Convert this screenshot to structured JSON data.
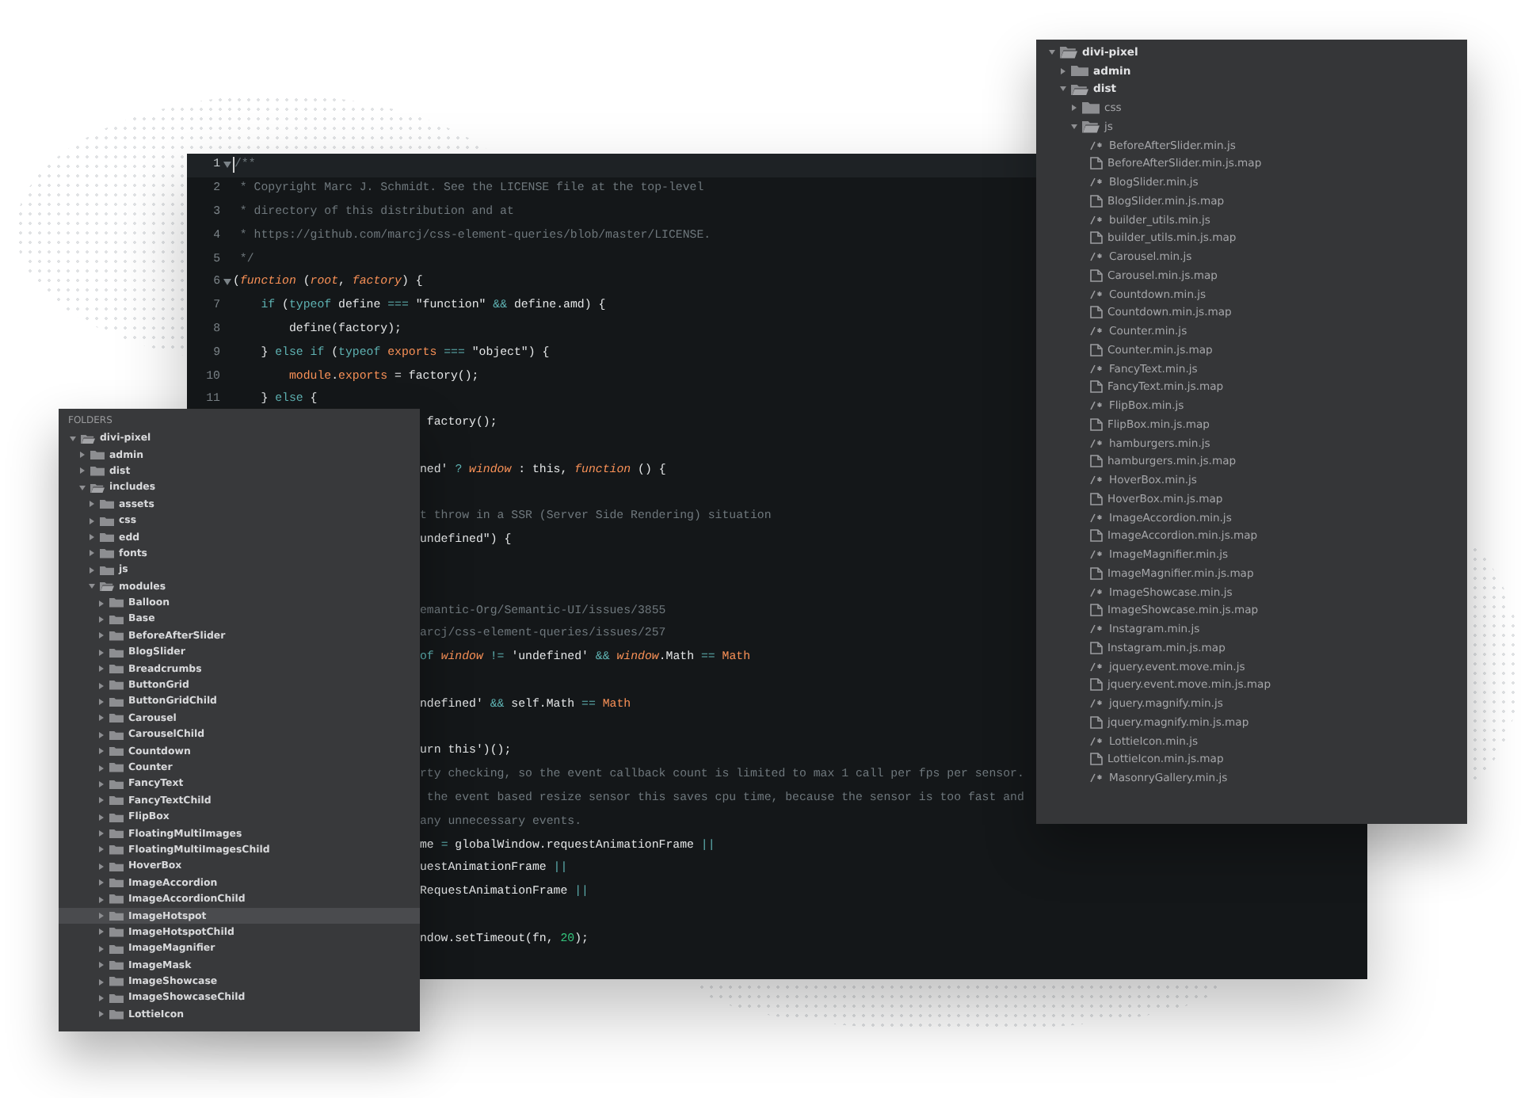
{
  "editor": {
    "lines": [
      {
        "kind": "full",
        "number": "1",
        "active": true,
        "foldable": true,
        "tokens": [
          {
            "t": "/**",
            "kind": "comment"
          }
        ]
      },
      {
        "kind": "full",
        "number": "2",
        "active": false,
        "foldable": false,
        "tokens": [
          {
            "t": " * Copyright Marc J. Schmidt. See the LICENSE file at the top-level",
            "kind": "comment"
          }
        ]
      },
      {
        "kind": "full",
        "number": "3",
        "active": false,
        "foldable": false,
        "tokens": [
          {
            "t": " * directory of this distribution and at",
            "kind": "comment"
          }
        ]
      },
      {
        "kind": "full",
        "number": "4",
        "active": false,
        "foldable": false,
        "tokens": [
          {
            "t": " * https://github.com/marcj/css-element-queries/blob/master/LICENSE.",
            "kind": "comment"
          }
        ]
      },
      {
        "kind": "full",
        "number": "5",
        "active": false,
        "foldable": false,
        "tokens": [
          {
            "t": " */",
            "kind": "comment"
          }
        ]
      },
      {
        "kind": "full",
        "number": "6",
        "active": false,
        "foldable": true,
        "tokens": [
          {
            "t": "(",
            "kind": "plain"
          },
          {
            "t": "function",
            "kind": "variable"
          },
          {
            "t": " (",
            "kind": "plain"
          },
          {
            "t": "root",
            "kind": "variable"
          },
          {
            "t": ", ",
            "kind": "plain"
          },
          {
            "t": "factory",
            "kind": "variable"
          },
          {
            "t": ") {",
            "kind": "plain"
          }
        ]
      },
      {
        "kind": "full",
        "number": "7",
        "active": false,
        "foldable": false,
        "tokens": [
          {
            "t": "    if",
            "kind": "keyword"
          },
          {
            "t": " (",
            "kind": "plain"
          },
          {
            "t": "typeof",
            "kind": "keyword"
          },
          {
            "t": " define ",
            "kind": "plain"
          },
          {
            "t": "===",
            "kind": "operator"
          },
          {
            "t": " \"function\" ",
            "kind": "string"
          },
          {
            "t": "&&",
            "kind": "operator"
          },
          {
            "t": " define.amd) {",
            "kind": "plain"
          }
        ]
      },
      {
        "kind": "full",
        "number": "8",
        "active": false,
        "foldable": false,
        "tokens": [
          {
            "t": "        define(factory);",
            "kind": "plain"
          }
        ]
      },
      {
        "kind": "full",
        "number": "9",
        "active": false,
        "foldable": false,
        "tokens": [
          {
            "t": "    } ",
            "kind": "plain"
          },
          {
            "t": "else if",
            "kind": "keyword"
          },
          {
            "t": " (",
            "kind": "plain"
          },
          {
            "t": "typeof",
            "kind": "keyword"
          },
          {
            "t": " exports ",
            "kind": "property"
          },
          {
            "t": "===",
            "kind": "operator"
          },
          {
            "t": " \"object\"",
            "kind": "string"
          },
          {
            "t": ") {",
            "kind": "plain"
          }
        ]
      },
      {
        "kind": "full",
        "number": "10",
        "active": false,
        "foldable": false,
        "tokens": [
          {
            "t": "        module",
            "kind": "property"
          },
          {
            "t": ".",
            "kind": "plain"
          },
          {
            "t": "exports",
            "kind": "property"
          },
          {
            "t": " = factory();",
            "kind": "plain"
          }
        ]
      },
      {
        "kind": "full",
        "number": "11",
        "active": false,
        "foldable": false,
        "tokens": [
          {
            "t": "    } ",
            "kind": "plain"
          },
          {
            "t": "else",
            "kind": "keyword"
          },
          {
            "t": " {",
            "kind": "plain"
          }
        ]
      },
      {
        "kind": "clipped",
        "tokens": [
          {
            "t": " factory();",
            "kind": "plain"
          }
        ]
      },
      {
        "kind": "blank"
      },
      {
        "kind": "clipped",
        "tokens": [
          {
            "t": "ned' ",
            "kind": "string"
          },
          {
            "t": "?",
            "kind": "operator"
          },
          {
            "t": " window",
            "kind": "variable"
          },
          {
            "t": " : this, ",
            "kind": "plain"
          },
          {
            "t": "function",
            "kind": "variable"
          },
          {
            "t": " () {",
            "kind": "plain"
          }
        ]
      },
      {
        "kind": "blank"
      },
      {
        "kind": "clipped",
        "tokens": [
          {
            "t": "t throw in a SSR (Server Side Rendering) situation",
            "kind": "comment"
          }
        ]
      },
      {
        "kind": "clipped",
        "tokens": [
          {
            "t": "undefined\"",
            "kind": "string"
          },
          {
            "t": ") {",
            "kind": "plain"
          }
        ]
      },
      {
        "kind": "blank"
      },
      {
        "kind": "blank"
      },
      {
        "kind": "clipped",
        "tokens": [
          {
            "t": "emantic-Org/Semantic-UI/issues/3855",
            "kind": "comment"
          }
        ]
      },
      {
        "kind": "clipped",
        "tokens": [
          {
            "t": "arcj/css-element-queries/issues/257",
            "kind": "comment"
          }
        ]
      },
      {
        "kind": "clipped",
        "tokens": [
          {
            "t": "of ",
            "kind": "keyword"
          },
          {
            "t": "window",
            "kind": "variable"
          },
          {
            "t": " != ",
            "kind": "operator"
          },
          {
            "t": "'undefined' ",
            "kind": "string"
          },
          {
            "t": "&&",
            "kind": "operator"
          },
          {
            "t": " window",
            "kind": "variable"
          },
          {
            "t": ".Math ",
            "kind": "plain"
          },
          {
            "t": "==",
            "kind": "operator"
          },
          {
            "t": " Math",
            "kind": "property"
          }
        ]
      },
      {
        "kind": "blank"
      },
      {
        "kind": "clipped",
        "tokens": [
          {
            "t": "ndefined' ",
            "kind": "string"
          },
          {
            "t": "&&",
            "kind": "operator"
          },
          {
            "t": " self.Math ",
            "kind": "plain"
          },
          {
            "t": "==",
            "kind": "operator"
          },
          {
            "t": " Math",
            "kind": "property"
          }
        ]
      },
      {
        "kind": "blank"
      },
      {
        "kind": "clipped",
        "tokens": [
          {
            "t": "urn this')();",
            "kind": "plain"
          }
        ]
      },
      {
        "kind": "clipped",
        "tokens": [
          {
            "t": "rty checking, so the event callback count is limited to max 1 call per fps per sensor.",
            "kind": "comment"
          }
        ]
      },
      {
        "kind": "clipped",
        "tokens": [
          {
            "t": " the event based resize sensor this saves cpu time, because the sensor is too fast and",
            "kind": "comment"
          }
        ]
      },
      {
        "kind": "clipped",
        "tokens": [
          {
            "t": "any unnecessary events.",
            "kind": "comment"
          }
        ]
      },
      {
        "kind": "clipped",
        "tokens": [
          {
            "t": "me ",
            "kind": "plain"
          },
          {
            "t": "=",
            "kind": "operator"
          },
          {
            "t": " globalWindow.requestAnimationFrame ",
            "kind": "plain"
          },
          {
            "t": "||",
            "kind": "operator"
          }
        ]
      },
      {
        "kind": "clipped",
        "tokens": [
          {
            "t": "uestAnimationFrame ",
            "kind": "plain"
          },
          {
            "t": "||",
            "kind": "operator"
          }
        ]
      },
      {
        "kind": "clipped",
        "tokens": [
          {
            "t": "RequestAnimationFrame ",
            "kind": "plain"
          },
          {
            "t": "||",
            "kind": "operator"
          }
        ]
      },
      {
        "kind": "blank"
      },
      {
        "kind": "clipped",
        "tokens": [
          {
            "t": "ndow.setTimeout(fn, ",
            "kind": "plain"
          },
          {
            "t": "20",
            "kind": "number"
          },
          {
            "t": ");",
            "kind": "plain"
          }
        ]
      }
    ]
  },
  "folders_panel": {
    "title": "FOLDERS",
    "tree": [
      {
        "name": "divi-pixel",
        "kind": "folder",
        "expanded": true,
        "selected": false,
        "children": [
          {
            "name": "admin",
            "kind": "folder",
            "expanded": false,
            "selected": false
          },
          {
            "name": "dist",
            "kind": "folder",
            "expanded": false,
            "selected": false
          },
          {
            "name": "includes",
            "kind": "folder",
            "expanded": true,
            "selected": false,
            "children": [
              {
                "name": "assets",
                "kind": "folder",
                "expanded": false,
                "selected": false
              },
              {
                "name": "css",
                "kind": "folder",
                "expanded": false,
                "selected": false
              },
              {
                "name": "edd",
                "kind": "folder",
                "expanded": false,
                "selected": false
              },
              {
                "name": "fonts",
                "kind": "folder",
                "expanded": false,
                "selected": false
              },
              {
                "name": "js",
                "kind": "folder",
                "expanded": false,
                "selected": false
              },
              {
                "name": "modules",
                "kind": "folder",
                "expanded": true,
                "selected": false,
                "children": [
                  {
                    "name": "Balloon",
                    "kind": "folder",
                    "expanded": false,
                    "selected": false
                  },
                  {
                    "name": "Base",
                    "kind": "folder",
                    "expanded": false,
                    "selected": false
                  },
                  {
                    "name": "BeforeAfterSlider",
                    "kind": "folder",
                    "expanded": false,
                    "selected": false
                  },
                  {
                    "name": "BlogSlider",
                    "kind": "folder",
                    "expanded": false,
                    "selected": false
                  },
                  {
                    "name": "Breadcrumbs",
                    "kind": "folder",
                    "expanded": false,
                    "selected": false
                  },
                  {
                    "name": "ButtonGrid",
                    "kind": "folder",
                    "expanded": false,
                    "selected": false
                  },
                  {
                    "name": "ButtonGridChild",
                    "kind": "folder",
                    "expanded": false,
                    "selected": false
                  },
                  {
                    "name": "Carousel",
                    "kind": "folder",
                    "expanded": false,
                    "selected": false
                  },
                  {
                    "name": "CarouselChild",
                    "kind": "folder",
                    "expanded": false,
                    "selected": false
                  },
                  {
                    "name": "Countdown",
                    "kind": "folder",
                    "expanded": false,
                    "selected": false
                  },
                  {
                    "name": "Counter",
                    "kind": "folder",
                    "expanded": false,
                    "selected": false
                  },
                  {
                    "name": "FancyText",
                    "kind": "folder",
                    "expanded": false,
                    "selected": false
                  },
                  {
                    "name": "FancyTextChild",
                    "kind": "folder",
                    "expanded": false,
                    "selected": false
                  },
                  {
                    "name": "FlipBox",
                    "kind": "folder",
                    "expanded": false,
                    "selected": false
                  },
                  {
                    "name": "FloatingMultiImages",
                    "kind": "folder",
                    "expanded": false,
                    "selected": false
                  },
                  {
                    "name": "FloatingMultiImagesChild",
                    "kind": "folder",
                    "expanded": false,
                    "selected": false
                  },
                  {
                    "name": "HoverBox",
                    "kind": "folder",
                    "expanded": false,
                    "selected": false
                  },
                  {
                    "name": "ImageAccordion",
                    "kind": "folder",
                    "expanded": false,
                    "selected": false
                  },
                  {
                    "name": "ImageAccordionChild",
                    "kind": "folder",
                    "expanded": false,
                    "selected": false
                  },
                  {
                    "name": "ImageHotspot",
                    "kind": "folder",
                    "expanded": false,
                    "selected": true
                  },
                  {
                    "name": "ImageHotspotChild",
                    "kind": "folder",
                    "expanded": false,
                    "selected": false
                  },
                  {
                    "name": "ImageMagnifier",
                    "kind": "folder",
                    "expanded": false,
                    "selected": false
                  },
                  {
                    "name": "ImageMask",
                    "kind": "folder",
                    "expanded": false,
                    "selected": false
                  },
                  {
                    "name": "ImageShowcase",
                    "kind": "folder",
                    "expanded": false,
                    "selected": false
                  },
                  {
                    "name": "ImageShowcaseChild",
                    "kind": "folder",
                    "expanded": false,
                    "selected": false
                  },
                  {
                    "name": "LottieIcon",
                    "kind": "folder",
                    "expanded": false,
                    "selected": false
                  }
                ]
              }
            ]
          }
        ]
      }
    ]
  },
  "files_panel": {
    "tree": [
      {
        "name": "divi-pixel",
        "kind": "folder",
        "expanded": true,
        "children": [
          {
            "name": "admin",
            "kind": "folder",
            "expanded": false
          },
          {
            "name": "dist",
            "kind": "folder",
            "expanded": true,
            "children": [
              {
                "name": "css",
                "kind": "folder",
                "expanded": false
              },
              {
                "name": "js",
                "kind": "folder",
                "expanded": true,
                "children": [
                  {
                    "name": "BeforeAfterSlider.min.js",
                    "kind": "script"
                  },
                  {
                    "name": "BeforeAfterSlider.min.js.map",
                    "kind": "file"
                  },
                  {
                    "name": "BlogSlider.min.js",
                    "kind": "script"
                  },
                  {
                    "name": "BlogSlider.min.js.map",
                    "kind": "file"
                  },
                  {
                    "name": "builder_utils.min.js",
                    "kind": "script"
                  },
                  {
                    "name": "builder_utils.min.js.map",
                    "kind": "file"
                  },
                  {
                    "name": "Carousel.min.js",
                    "kind": "script"
                  },
                  {
                    "name": "Carousel.min.js.map",
                    "kind": "file"
                  },
                  {
                    "name": "Countdown.min.js",
                    "kind": "script"
                  },
                  {
                    "name": "Countdown.min.js.map",
                    "kind": "file"
                  },
                  {
                    "name": "Counter.min.js",
                    "kind": "script"
                  },
                  {
                    "name": "Counter.min.js.map",
                    "kind": "file"
                  },
                  {
                    "name": "FancyText.min.js",
                    "kind": "script"
                  },
                  {
                    "name": "FancyText.min.js.map",
                    "kind": "file"
                  },
                  {
                    "name": "FlipBox.min.js",
                    "kind": "script"
                  },
                  {
                    "name": "FlipBox.min.js.map",
                    "kind": "file"
                  },
                  {
                    "name": "hamburgers.min.js",
                    "kind": "script"
                  },
                  {
                    "name": "hamburgers.min.js.map",
                    "kind": "file"
                  },
                  {
                    "name": "HoverBox.min.js",
                    "kind": "script"
                  },
                  {
                    "name": "HoverBox.min.js.map",
                    "kind": "file"
                  },
                  {
                    "name": "ImageAccordion.min.js",
                    "kind": "script"
                  },
                  {
                    "name": "ImageAccordion.min.js.map",
                    "kind": "file"
                  },
                  {
                    "name": "ImageMagnifier.min.js",
                    "kind": "script"
                  },
                  {
                    "name": "ImageMagnifier.min.js.map",
                    "kind": "file"
                  },
                  {
                    "name": "ImageShowcase.min.js",
                    "kind": "script"
                  },
                  {
                    "name": "ImageShowcase.min.js.map",
                    "kind": "file"
                  },
                  {
                    "name": "Instagram.min.js",
                    "kind": "script"
                  },
                  {
                    "name": "Instagram.min.js.map",
                    "kind": "file"
                  },
                  {
                    "name": "jquery.event.move.min.js",
                    "kind": "script"
                  },
                  {
                    "name": "jquery.event.move.min.js.map",
                    "kind": "file"
                  },
                  {
                    "name": "jquery.magnify.min.js",
                    "kind": "script"
                  },
                  {
                    "name": "jquery.magnify.min.js.map",
                    "kind": "file"
                  },
                  {
                    "name": "LottieIcon.min.js",
                    "kind": "script"
                  },
                  {
                    "name": "LottieIcon.min.js.map",
                    "kind": "file"
                  },
                  {
                    "name": "MasonryGallery.min.js",
                    "kind": "script"
                  }
                ]
              }
            ]
          }
        ]
      }
    ]
  }
}
